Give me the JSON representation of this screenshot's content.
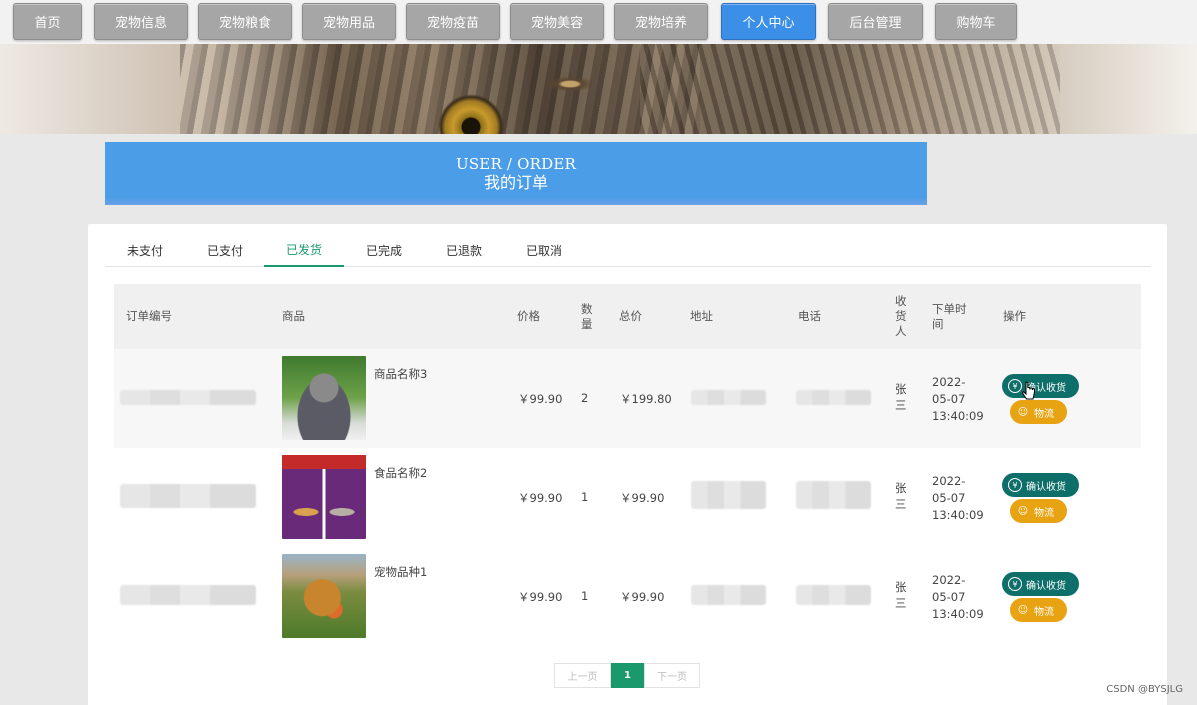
{
  "nav": {
    "items": [
      {
        "label": "首页",
        "active": false
      },
      {
        "label": "宠物信息",
        "active": false
      },
      {
        "label": "宠物粮食",
        "active": false
      },
      {
        "label": "宠物用品",
        "active": false
      },
      {
        "label": "宠物疫苗",
        "active": false
      },
      {
        "label": "宠物美容",
        "active": false
      },
      {
        "label": "宠物培养",
        "active": false
      },
      {
        "label": "个人中心",
        "active": true
      },
      {
        "label": "后台管理",
        "active": false
      },
      {
        "label": "购物车",
        "active": false
      }
    ]
  },
  "title": {
    "en": "USER / ORDER",
    "cn": "我的订单"
  },
  "tabs": [
    {
      "label": "未支付"
    },
    {
      "label": "已支付"
    },
    {
      "label": "已发货",
      "active": true
    },
    {
      "label": "已完成"
    },
    {
      "label": "已退款"
    },
    {
      "label": "已取消"
    }
  ],
  "table": {
    "headers": {
      "order_no": "订单编号",
      "product": "商品",
      "price": "价格",
      "qty": "数\n量",
      "total": "总价",
      "address": "地址",
      "phone": "电话",
      "receiver": "收\n货\n人",
      "time": "下单时\n间",
      "actions": "操作"
    },
    "rows": [
      {
        "name": "商品名称3",
        "price": "￥99.90",
        "qty": "2",
        "total": "￥199.80",
        "receiver": "张\n三",
        "time": "2022-\n05-07\n13:40:09"
      },
      {
        "name": "食品名称2",
        "price": "￥99.90",
        "qty": "1",
        "total": "￥99.90",
        "receiver": "张\n三",
        "time": "2022-\n05-07\n13:40:09"
      },
      {
        "name": "宠物品种1",
        "price": "￥99.90",
        "qty": "1",
        "total": "￥99.90",
        "receiver": "张\n三",
        "time": "2022-\n05-07\n13:40:09"
      }
    ],
    "confirm_label": "确认收货",
    "logistics_label": "物流"
  },
  "pager": {
    "prev": "上一页",
    "current": "1",
    "next": "下一页"
  },
  "watermark": "CSDN @BYSJLG",
  "colors": {
    "accent": "#1a9a6c",
    "active_nav": "#3b8fe6",
    "confirm": "#0e6e6a",
    "logistics": "#e8a312"
  }
}
